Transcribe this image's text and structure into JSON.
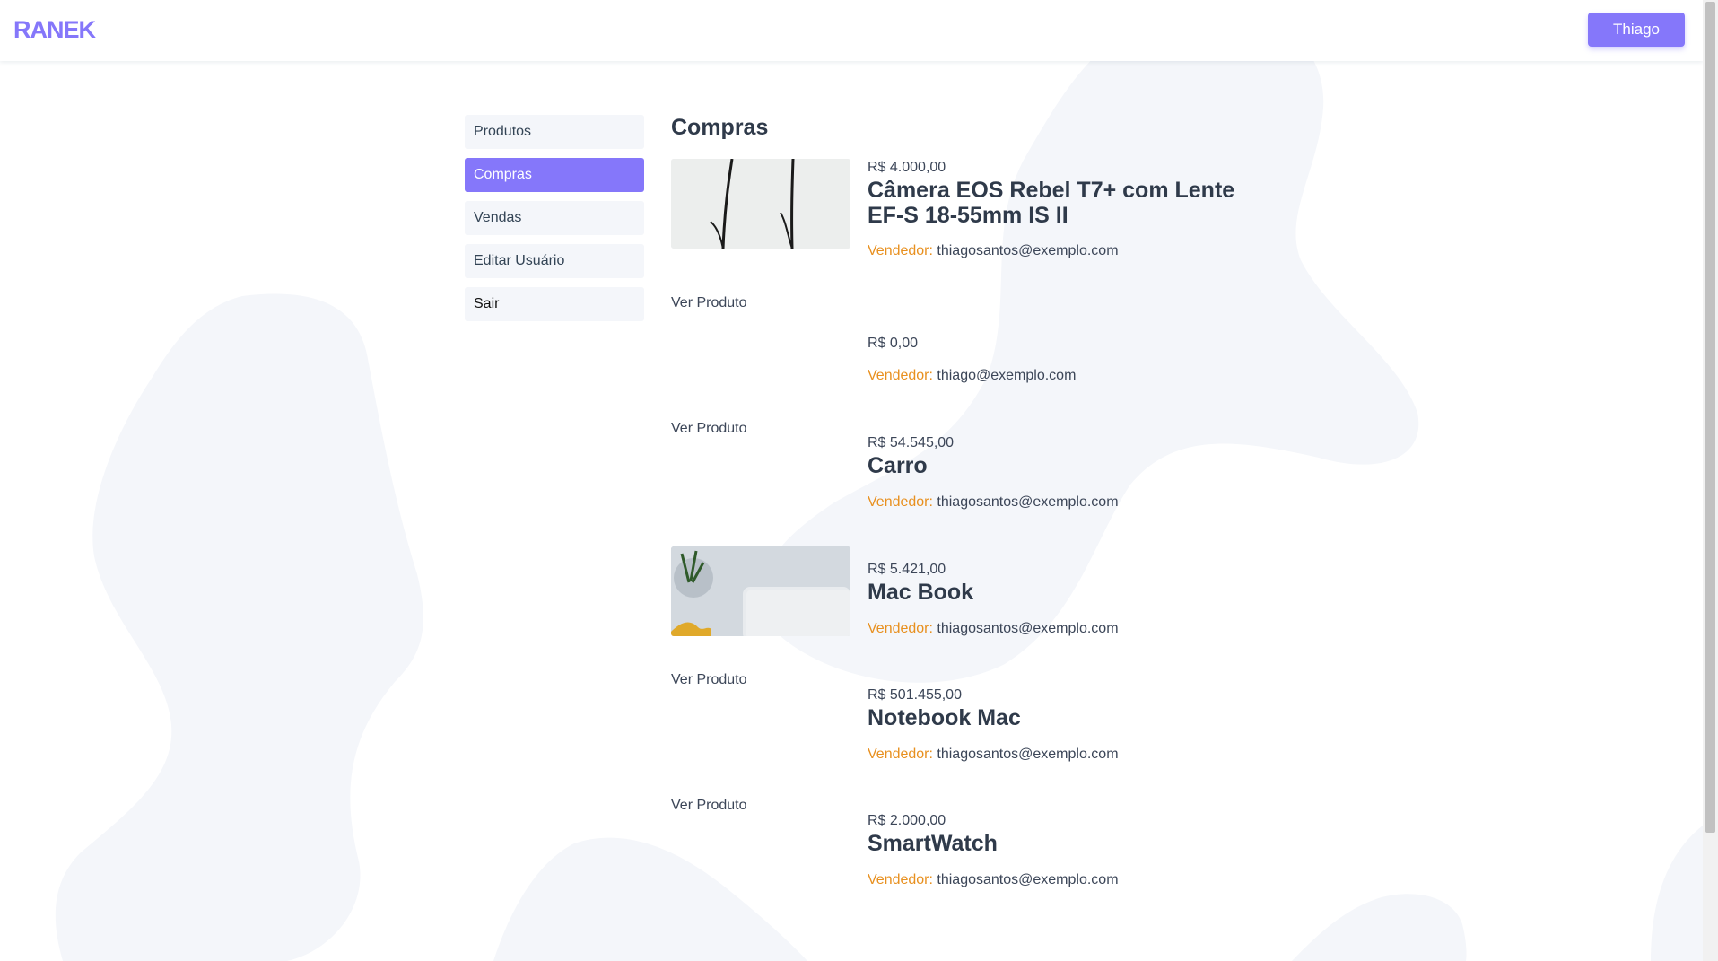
{
  "header": {
    "logo_text": "RANEK",
    "user_button": "Thiago",
    "accent_color": "#8577fa"
  },
  "sidebar": {
    "items": [
      {
        "label": "Produtos",
        "active": false
      },
      {
        "label": "Compras",
        "active": true
      },
      {
        "label": "Vendas",
        "active": false
      },
      {
        "label": "Editar Usuário",
        "active": false
      },
      {
        "label": "Sair",
        "active": false
      }
    ]
  },
  "main": {
    "title": "Compras",
    "seller_label": "Vendedor:",
    "view_link": "Ver Produto",
    "purchases": [
      {
        "price": "R$ 4.000,00",
        "name": "Câmera EOS Rebel T7+ com Lente EF-S 18-55mm IS II",
        "seller": "thiagosantos@exemplo.com",
        "image": "photo-stems"
      },
      {
        "price": "R$ 0,00",
        "name": "",
        "seller": "thiago@exemplo.com",
        "image": "none"
      },
      {
        "price": "R$ 54.545,00",
        "name": "Carro",
        "seller": "thiagosantos@exemplo.com",
        "image": "none"
      },
      {
        "price": "R$ 5.421,00",
        "name": "Mac Book",
        "seller": "thiagosantos@exemplo.com",
        "image": "photo-laptop"
      },
      {
        "price": "R$ 501.455,00",
        "name": "Notebook Mac",
        "seller": "thiagosantos@exemplo.com",
        "image": "none"
      },
      {
        "price": "R$ 2.000,00",
        "name": "SmartWatch",
        "seller": "thiagosantos@exemplo.com",
        "image": "none"
      }
    ]
  }
}
